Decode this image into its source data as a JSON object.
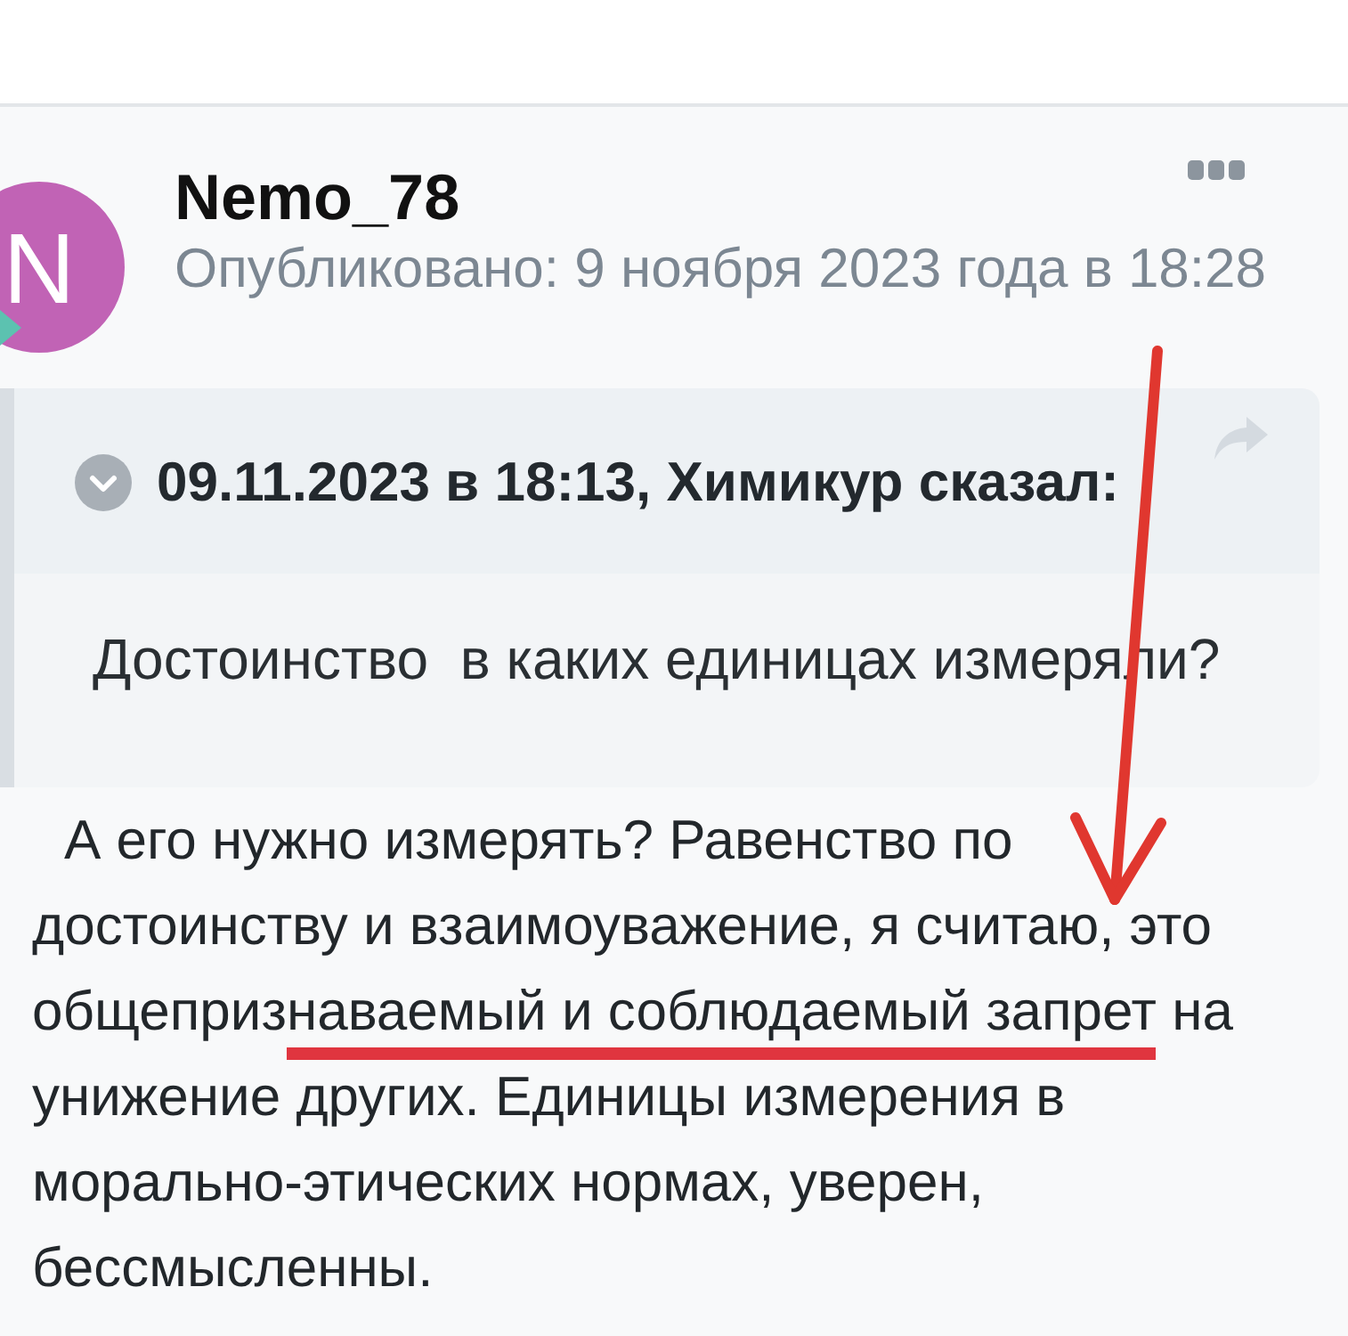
{
  "post": {
    "avatar": {
      "letter": "N"
    },
    "author": "Nemo_78",
    "published": "Опубликовано: 9 ноября 2023 года в 18:28",
    "quote": {
      "header": "09.11.2023 в 18:13, Химикур сказал:",
      "text": "Достоинство  в каких единицах измеряли?"
    },
    "body": [
      {
        "text": "А его нужно измерять? Равенство по достоинству и взаимоуважение, я считаю, это общеприз",
        "marked": false
      },
      {
        "text": "наваемый и соблюдаемый запрет",
        "marked": true
      },
      {
        "text": " на унижение других. Единицы измерения в морально-этических нормах, уверен, бессмысленны.",
        "marked": false
      }
    ]
  },
  "annotations": [
    {
      "kind": "arrow"
    }
  ]
}
